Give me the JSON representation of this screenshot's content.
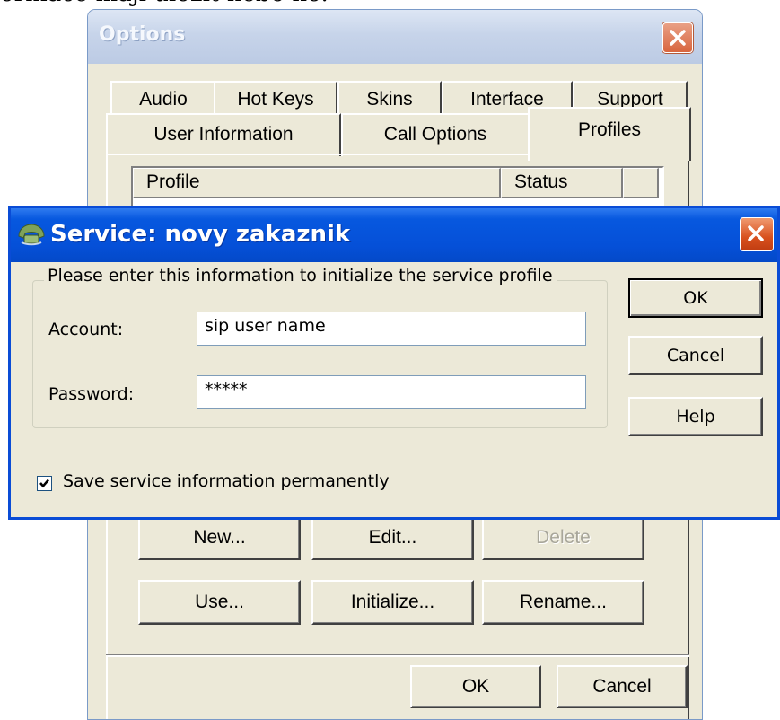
{
  "background_text": "ormace mají uložit nebo ne.",
  "options_window": {
    "title": "Options",
    "tabs_row1": [
      "Audio",
      "Hot Keys",
      "Skins",
      "Interface",
      "Support"
    ],
    "tabs_row2": [
      "User Information",
      "Call Options",
      "Profiles"
    ],
    "active_tab": "Profiles",
    "list_columns": [
      "Profile",
      "Status"
    ],
    "buttons": {
      "new": "New...",
      "edit": "Edit...",
      "delete": "Delete",
      "use": "Use...",
      "initialize": "Initialize...",
      "rename": "Rename..."
    },
    "ok": "OK",
    "cancel": "Cancel"
  },
  "service_dialog": {
    "title": "Service: novy zakaznik",
    "group_label": "Please enter this information to initialize the service profile",
    "account_label": "Account:",
    "account_value": "sip user name",
    "password_label": "Password:",
    "password_value": "*****",
    "ok": "OK",
    "cancel": "Cancel",
    "help": "Help",
    "save_checkbox_label": "Save service information permanently",
    "save_checked": true,
    "accent_color": "#0558de",
    "close_color": "#d8501d"
  }
}
